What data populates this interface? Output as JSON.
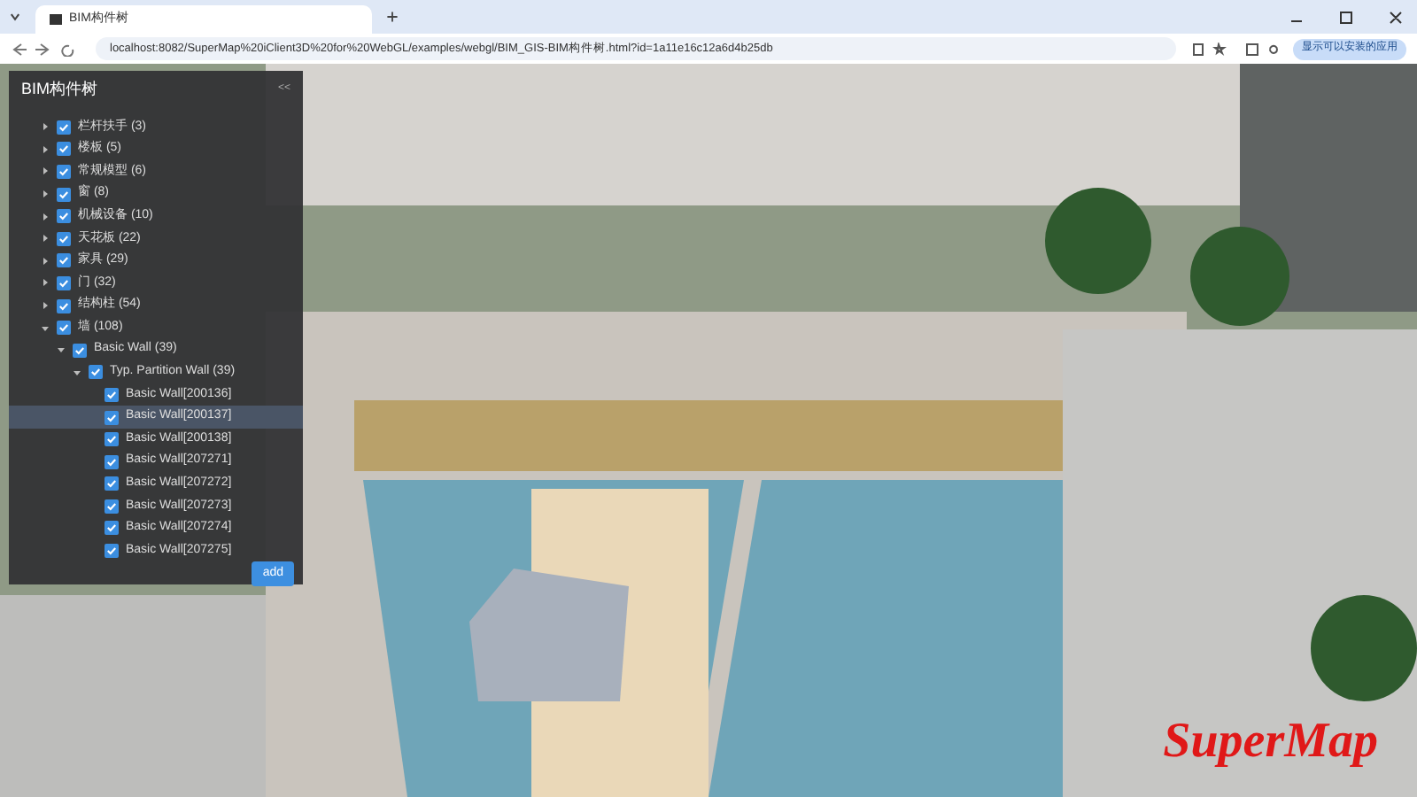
{
  "browser": {
    "tab_title": "BIM构件树",
    "url": "localhost:8082/SuperMap%20iClient3D%20for%20WebGL/examples/webgl/BIM_GIS-BIM构件树.html?id=1a11e16c12a6d4b25db",
    "profile_button": "显示可以安装的应用"
  },
  "panel": {
    "title": "BIM构件树",
    "collapse_symbol": "<<",
    "tree": [
      {
        "label": "栏杆扶手 (3)",
        "checked": true,
        "expanded": false,
        "selected": false
      },
      {
        "label": "楼板 (5)",
        "checked": true,
        "expanded": false,
        "selected": false
      },
      {
        "label": "常规模型 (6)",
        "checked": true,
        "expanded": false,
        "selected": false
      },
      {
        "label": "窗 (8)",
        "checked": true,
        "expanded": false,
        "selected": false
      },
      {
        "label": "机械设备 (10)",
        "checked": true,
        "expanded": false,
        "selected": false
      },
      {
        "label": "天花板 (22)",
        "checked": true,
        "expanded": false,
        "selected": false
      },
      {
        "label": "家具 (29)",
        "checked": true,
        "expanded": false,
        "selected": false
      },
      {
        "label": "门 (32)",
        "checked": true,
        "expanded": false,
        "selected": false
      },
      {
        "label": "结构柱 (54)",
        "checked": true,
        "expanded": false,
        "selected": false
      },
      {
        "label": "墙 (108)",
        "checked": true,
        "expanded": true,
        "selected": false,
        "children": [
          {
            "label": "Basic Wall (39)",
            "checked": true,
            "expanded": true,
            "selected": false,
            "children": [
              {
                "label": "Typ. Partition Wall (39)",
                "checked": true,
                "expanded": true,
                "selected": false,
                "children": [
                  {
                    "label": "Basic Wall[200136]",
                    "checked": true,
                    "selected": false
                  },
                  {
                    "label": "Basic Wall[200137]",
                    "checked": true,
                    "selected": true
                  },
                  {
                    "label": "Basic Wall[200138]",
                    "checked": true,
                    "selected": false
                  },
                  {
                    "label": "Basic Wall[207271]",
                    "checked": true,
                    "selected": false
                  },
                  {
                    "label": "Basic Wall[207272]",
                    "checked": true,
                    "selected": false
                  },
                  {
                    "label": "Basic Wall[207273]",
                    "checked": true,
                    "selected": false
                  },
                  {
                    "label": "Basic Wall[207274]",
                    "checked": true,
                    "selected": false
                  },
                  {
                    "label": "Basic Wall[207275]",
                    "checked": true,
                    "selected": false
                  }
                ]
              }
            ]
          }
        ]
      }
    ],
    "button": "add"
  },
  "logo": "SuperMap"
}
